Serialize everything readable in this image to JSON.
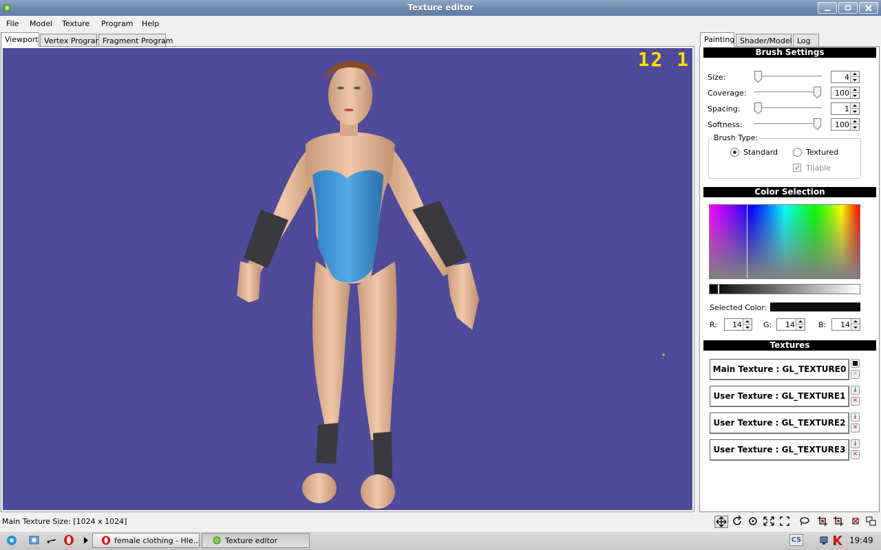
{
  "window": {
    "title": "Texture editor"
  },
  "menu": [
    "File",
    "Model",
    "Texture",
    "Program",
    "Help"
  ],
  "left_tabs": [
    "Viewport",
    "Vertex Program",
    "Fragment Program"
  ],
  "right_tabs": [
    "Painting",
    "Shader/Model",
    "Log"
  ],
  "viewport": {
    "fps": "12 1",
    "background": "#4f4b9a"
  },
  "brush": {
    "header": "Brush Settings",
    "size": {
      "label": "Size:",
      "value": "4",
      "level": 0.0
    },
    "coverage": {
      "label": "Coverage:",
      "value": "100",
      "level": 1.0
    },
    "spacing": {
      "label": "Spacing:",
      "value": "1",
      "level": 0.0
    },
    "softness": {
      "label": "Softness:",
      "value": "100",
      "level": 1.0
    },
    "type_title": "Brush Type:",
    "standard": "Standard",
    "textured": "Textured",
    "tilable": "Tilable"
  },
  "color": {
    "header": "Color Selection",
    "selected_label": "Selected Color:",
    "selected_hex": "#0e0e0e",
    "r_label": "R:",
    "r": "14",
    "g_label": "G:",
    "g": "14",
    "b_label": "B:",
    "b": "14"
  },
  "textures": {
    "header": "Textures",
    "items": [
      "Main Texture : GL_TEXTURE0",
      "User Texture : GL_TEXTURE1",
      "User Texture : GL_TEXTURE2",
      "User Texture : GL_TEXTURE3"
    ]
  },
  "status": {
    "text": "Main Texture Size: [1024 x 1024]"
  },
  "taskbar": {
    "tasks": [
      "female clothing - Hle...",
      "Texture editor"
    ],
    "lang": "CS",
    "clock": "19:49"
  }
}
